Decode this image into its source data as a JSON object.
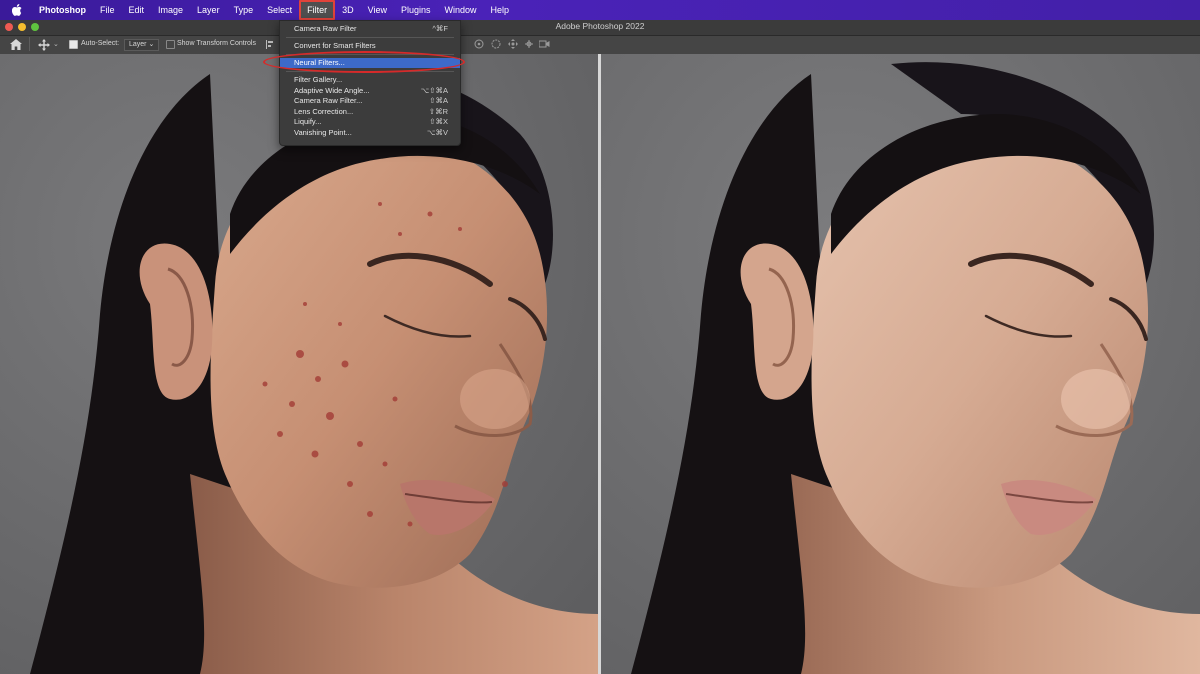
{
  "menubar": {
    "app_name": "Photoshop",
    "items": [
      "File",
      "Edit",
      "Image",
      "Layer",
      "Type",
      "Select",
      "Filter",
      "3D",
      "View",
      "Plugins",
      "Window",
      "Help"
    ],
    "active_item": "Filter",
    "accent": "#e0433a"
  },
  "titlebar": {
    "title": "Adobe Photoshop 2022"
  },
  "options_bar": {
    "auto_select_label": "Auto-Select:",
    "auto_select_value": "Layer",
    "show_transform_label": "Show Transform Controls"
  },
  "filter_menu": {
    "items": [
      {
        "label": "Camera Raw Filter",
        "shortcut": "^⌘F"
      },
      {
        "label": "Convert for Smart Filters",
        "shortcut": ""
      },
      {
        "label": "Neural Filters...",
        "shortcut": "",
        "highlighted": true
      },
      {
        "label": "Filter Gallery...",
        "shortcut": ""
      },
      {
        "label": "Adaptive Wide Angle...",
        "shortcut": "⌥⇧⌘A"
      },
      {
        "label": "Camera Raw Filter...",
        "shortcut": "⇧⌘A"
      },
      {
        "label": "Lens Correction...",
        "shortcut": "⇧⌘R"
      },
      {
        "label": "Liquify...",
        "shortcut": "⇧⌘X"
      },
      {
        "label": "Vanishing Point...",
        "shortcut": "⌥⌘V"
      }
    ],
    "highlight_color": "#3d6ac9",
    "annotation_color": "#d62a2a"
  },
  "canvas": {
    "before_label": "",
    "after_label": ""
  }
}
